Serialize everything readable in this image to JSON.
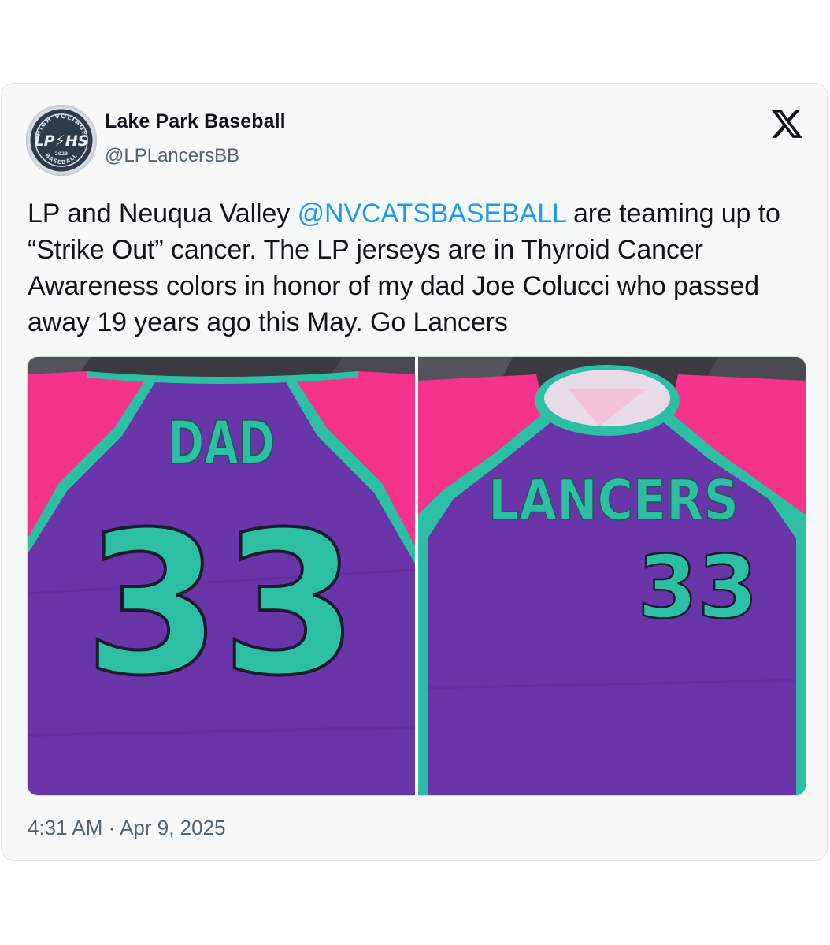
{
  "tweet": {
    "display_name": "Lake Park Baseball",
    "handle": "@LPLancersBB",
    "avatar_text": {
      "top": "HIGH VOLTAGE",
      "center": "LP⚡HS",
      "year": "2023",
      "bottom": "BASEBALL"
    },
    "text_before": "LP and Neuqua Valley ",
    "mention": "@NVCATSBASEBALL",
    "text_after": " are teaming up to “Strike Out” cancer.  The LP jerseys are in Thyroid Cancer Awareness colors in honor of my dad Joe Colucci who passed away 19 years ago this May. Go Lancers",
    "timestamp": "4:31 AM · Apr 9, 2025",
    "platform_icon": "x-logo-icon"
  },
  "media": {
    "left_photo": {
      "name_text": "DAD",
      "number_text": "33"
    },
    "right_photo": {
      "team_text": "LANCERS",
      "number_text": "33"
    }
  },
  "colors": {
    "jersey_purple": "#6a35a8",
    "jersey_pink": "#f5328c",
    "jersey_teal": "#2dbfa3",
    "link_blue": "#1d9bf0",
    "secondary_text": "#536471"
  }
}
